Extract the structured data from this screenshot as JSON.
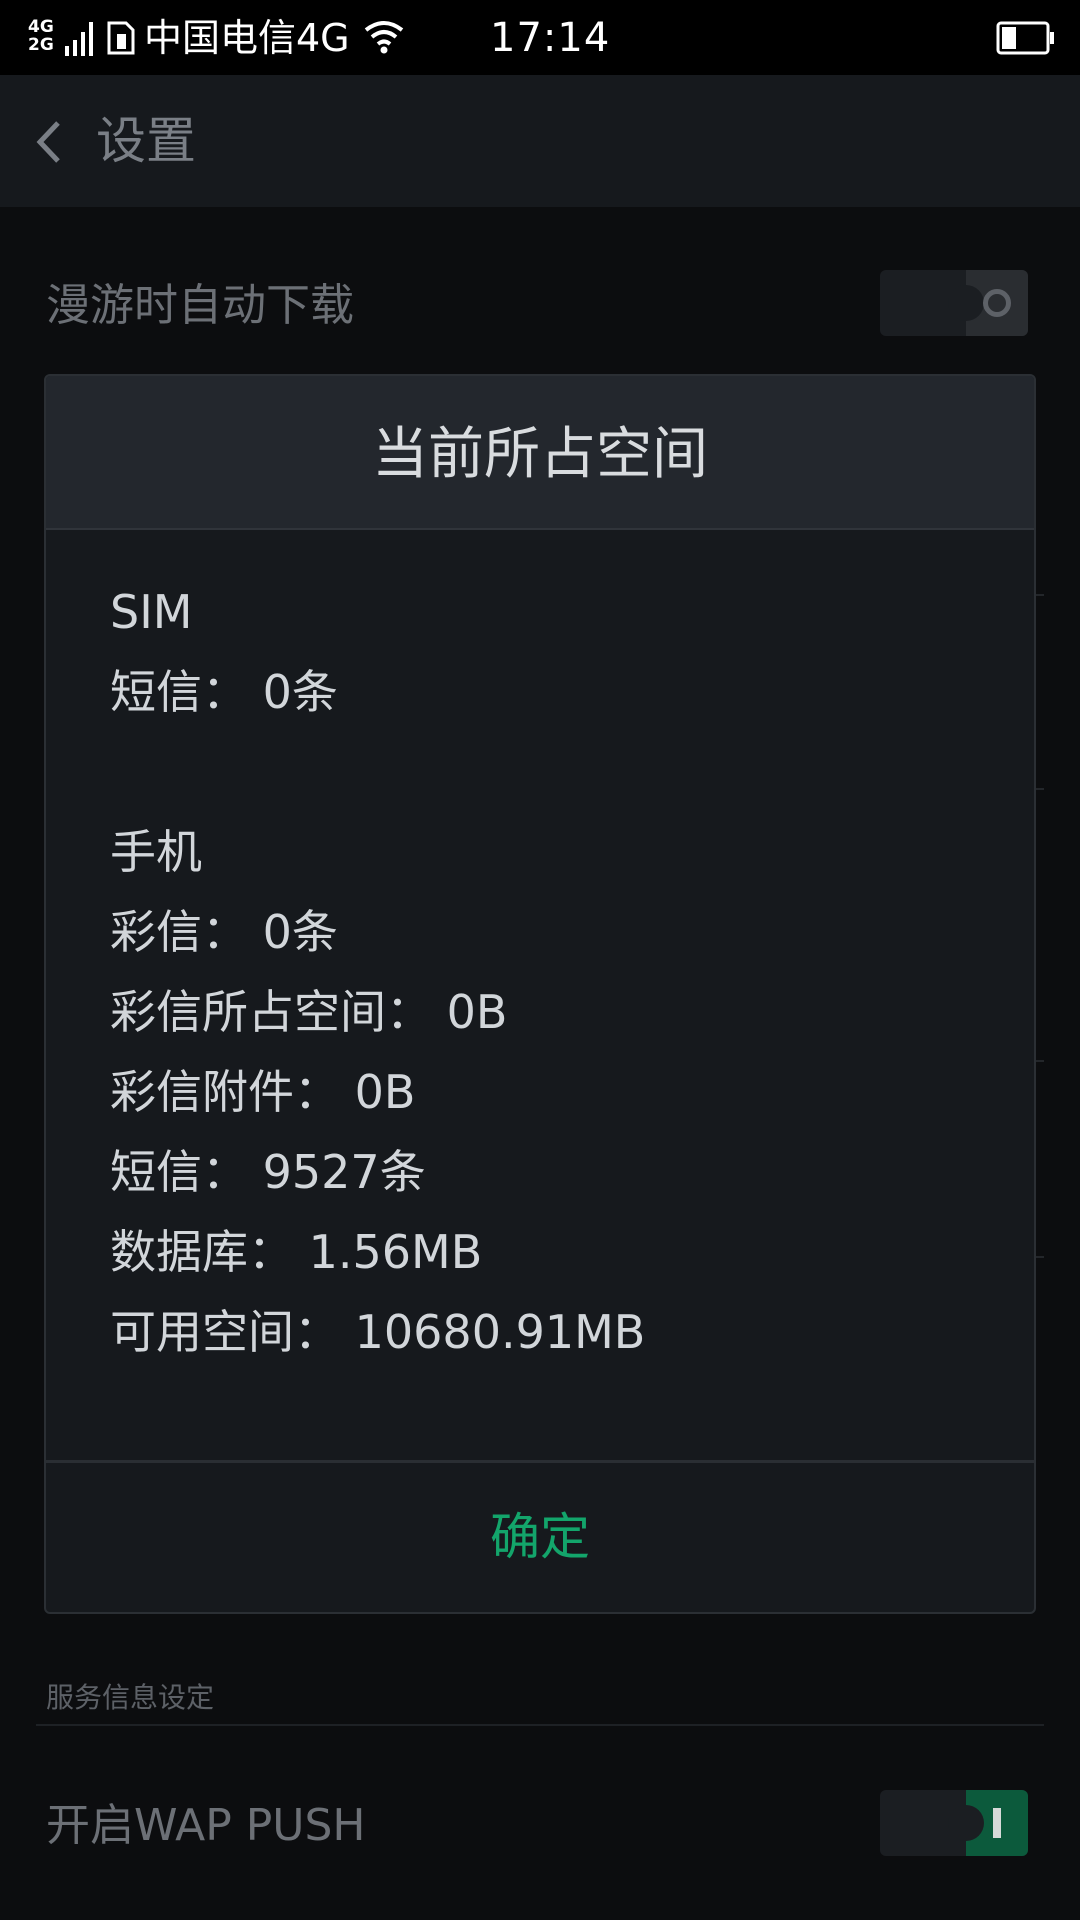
{
  "status_bar": {
    "network_type_top": "4G",
    "network_type_bottom": "2G",
    "carrier": "中国电信4G",
    "time": "17:14",
    "icons": [
      "signal-icon",
      "sim-icon",
      "wifi-icon",
      "battery-icon"
    ]
  },
  "app_bar": {
    "title": "设置",
    "back_icon": "chevron-left-icon"
  },
  "settings": {
    "roaming_auto_download_label": "漫游时自动下载",
    "roaming_auto_download_on": false,
    "section_service": "服务信息设定",
    "wap_push_label": "开启WAP PUSH",
    "wap_push_on": true
  },
  "dialog": {
    "title": "当前所占空间",
    "lines": [
      "SIM",
      "短信：  0条",
      "手机",
      "彩信：  0条",
      "彩信所占空间：  0B",
      "彩信附件：  0B",
      "短信：  9527条",
      "数据库：  1.56MB",
      "可用空间：  10680.91MB"
    ],
    "confirm_label": "确定"
  },
  "colors": {
    "accent_green": "#13a56b",
    "background": "#0c0d0f",
    "dialog_bg": "#16191d"
  }
}
